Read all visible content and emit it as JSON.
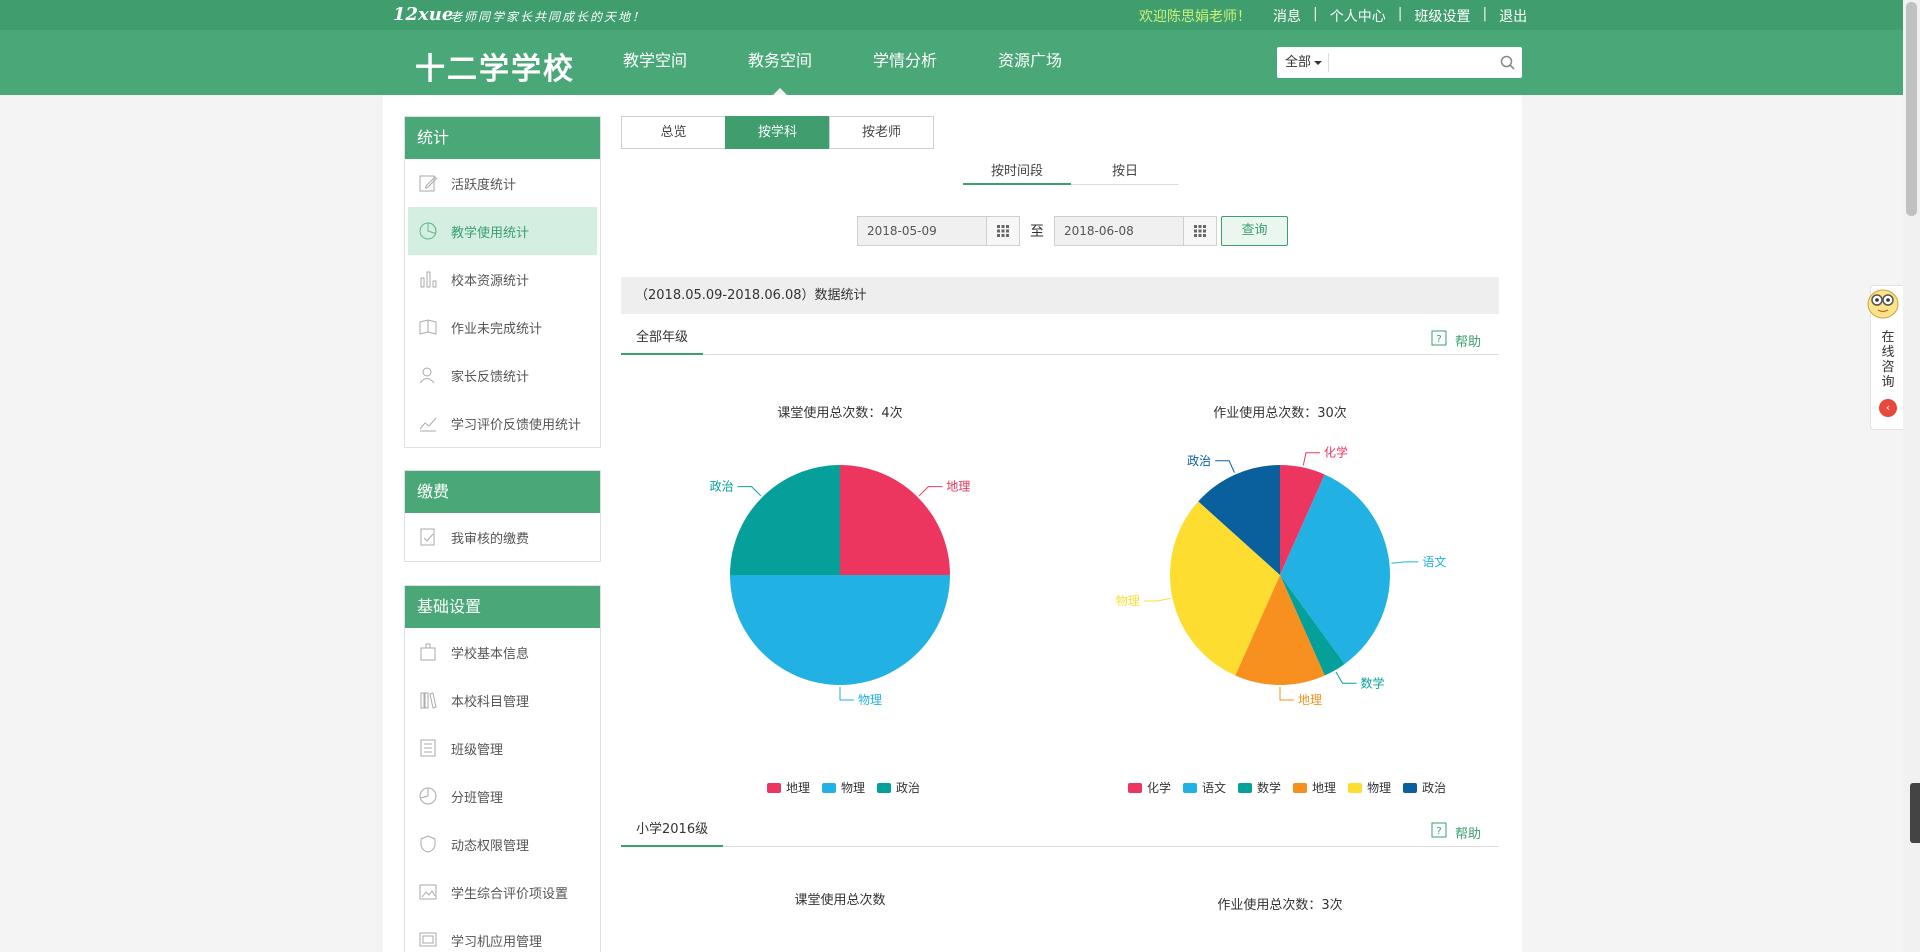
{
  "topbar": {
    "logo_text": "12xue",
    "slogan": "老师同学家长共同成长的天地！",
    "welcome": "欢迎陈思娟老师！",
    "links": [
      "消息",
      "个人中心",
      "班级设置",
      "退出"
    ]
  },
  "header": {
    "school_name": "十二学学校",
    "nav": [
      "教学空间",
      "教务空间",
      "学情分析",
      "资源广场"
    ],
    "active_nav": "教务空间",
    "search_scope": "全部",
    "search_placeholder": ""
  },
  "sidebar": {
    "groups": [
      {
        "title": "统计",
        "items": [
          {
            "label": "活跃度统计",
            "icon": "edit-icon"
          },
          {
            "label": "教学使用统计",
            "icon": "pie-chart-icon",
            "active": true
          },
          {
            "label": "校本资源统计",
            "icon": "bar-chart-icon"
          },
          {
            "label": "作业未完成统计",
            "icon": "book-icon"
          },
          {
            "label": "家长反馈统计",
            "icon": "user-icon"
          },
          {
            "label": "学习评价反馈使用统计",
            "icon": "trend-chart-icon"
          }
        ]
      },
      {
        "title": "缴费",
        "items": [
          {
            "label": "我审核的缴费",
            "icon": "document-check-icon"
          }
        ]
      },
      {
        "title": "基础设置",
        "items": [
          {
            "label": "学校基本信息",
            "icon": "building-icon"
          },
          {
            "label": "本校科目管理",
            "icon": "books-icon"
          },
          {
            "label": "班级管理",
            "icon": "classroom-icon"
          },
          {
            "label": "分班管理",
            "icon": "pie-icon"
          },
          {
            "label": "动态权限管理",
            "icon": "shield-icon"
          },
          {
            "label": "学生综合评价项设置",
            "icon": "image-icon"
          },
          {
            "label": "学习机应用管理",
            "icon": "device-icon"
          }
        ]
      }
    ]
  },
  "tabs": [
    "总览",
    "按学科",
    "按老师"
  ],
  "active_tab": "按学科",
  "subtabs": [
    "按时间段",
    "按日"
  ],
  "active_subtab": "按时间段",
  "date_range": {
    "start": "2018-05-09",
    "to_label": "至",
    "end": "2018-06-08",
    "query_label": "查询"
  },
  "stats_title": "（2018.05.09-2018.06.08）数据统计",
  "sections": [
    {
      "tab_label": "全部年级",
      "help_label": "帮助"
    },
    {
      "tab_label": "小学2016级",
      "help_label": "帮助"
    }
  ],
  "chart_data": [
    {
      "type": "pie",
      "title": "课堂使用总次数：4次",
      "categories": [
        "地理",
        "物理",
        "政治"
      ],
      "values": [
        1,
        2,
        1
      ],
      "colors": [
        "#ec3660",
        "#22b1e3",
        "#05a09a"
      ]
    },
    {
      "type": "pie",
      "title": "作业使用总次数：30次",
      "categories": [
        "化学",
        "语文",
        "数学",
        "地理",
        "物理",
        "政治"
      ],
      "values": [
        2,
        10,
        1,
        4,
        9,
        4
      ],
      "colors": [
        "#ec3660",
        "#22b1e3",
        "#05a09a",
        "#f7901e",
        "#fedd31",
        "#0a5f9d"
      ]
    },
    {
      "type": "pie",
      "title": "课堂使用总次数",
      "categories": [],
      "values": []
    },
    {
      "type": "pie",
      "title": "作业使用总次数：3次",
      "categories": [],
      "values": []
    }
  ],
  "float_service": {
    "label": "在线咨询"
  }
}
